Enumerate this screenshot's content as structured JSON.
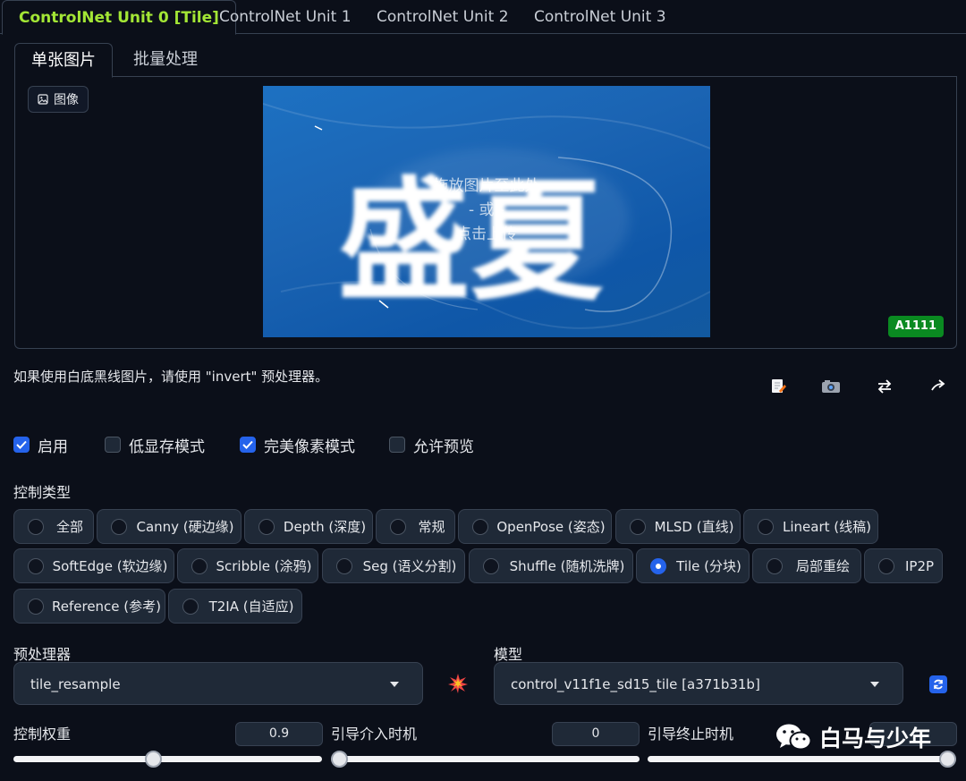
{
  "unit_tabs": [
    "ControlNet Unit 0 [Tile]",
    "ControlNet Unit 1",
    "ControlNet Unit 2",
    "ControlNet Unit 3"
  ],
  "sub_tabs": [
    "单张图片",
    "批量处理"
  ],
  "image": {
    "label": "图像",
    "calligraphy": "盛夏",
    "drop_line1": "拖放图片至此处",
    "drop_line2": "- 或 -",
    "drop_line3": "点击上传",
    "badge": "A1111"
  },
  "hint": "如果使用白底黑线图片，请使用 \"invert\" 预处理器。",
  "toolbar_icons": [
    "edit-icon",
    "camera-icon",
    "swap-icon",
    "send-dimensions-icon"
  ],
  "checkboxes": [
    {
      "label": "启用",
      "checked": true
    },
    {
      "label": "低显存模式",
      "checked": false
    },
    {
      "label": "完美像素模式",
      "checked": true
    },
    {
      "label": "允许预览",
      "checked": false
    }
  ],
  "control_type": {
    "label": "控制类型",
    "selected": "Tile (分块)",
    "options": [
      "全部",
      "Canny (硬边缘)",
      "Depth (深度)",
      "常规",
      "OpenPose (姿态)",
      "MLSD (直线)",
      "Lineart (线稿)",
      "SoftEdge (软边缘)",
      "Scribble (涂鸦)",
      "Seg (语义分割)",
      "Shuffle (随机洗牌)",
      "Tile (分块)",
      "局部重绘",
      "IP2P",
      "Reference (参考)",
      "T2IA (自适应)"
    ]
  },
  "preprocessor": {
    "label": "预处理器",
    "value": "tile_resample"
  },
  "model": {
    "label": "模型",
    "value": "control_v11f1e_sd15_tile [a371b31b]"
  },
  "sliders": {
    "weight": {
      "label": "控制权重",
      "value": "0.9",
      "fraction": 0.45
    },
    "start": {
      "label": "引导介入时机",
      "value": "0",
      "fraction": 0
    },
    "end": {
      "label": "引导终止时机",
      "fraction": 1
    }
  },
  "watermark": "白马与少年",
  "colors": {
    "accent": "#a3e635",
    "primary": "#2563eb",
    "badge": "#0a8a21",
    "background": "#0b0f19"
  }
}
